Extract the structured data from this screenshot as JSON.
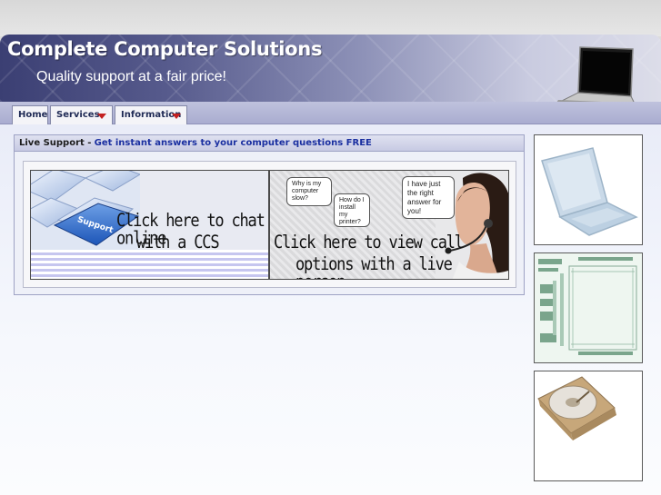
{
  "site": {
    "title": "Complete Computer Solutions",
    "tagline": "Quality support at a fair price!"
  },
  "nav": {
    "tabs": [
      {
        "label": "Home",
        "has_dropdown": false
      },
      {
        "label": "Services",
        "has_dropdown": true
      },
      {
        "label": "Information",
        "has_dropdown": true
      }
    ]
  },
  "live_support": {
    "heading": "Live Support -",
    "link_text": "Get instant answers to your computer questions FREE",
    "chat_promo": {
      "key_label": "Support",
      "line1": "Click here to chat online",
      "line2": "with a CCS technician."
    },
    "call_promo": {
      "bubble1": "Why is my computer slow?",
      "bubble2": "How do I install my printer?",
      "bubble3": "I have just the right answer for you!",
      "line1": "Click here to view call",
      "line2": "options with a live person."
    }
  },
  "colors": {
    "accent_link": "#1a2fa0",
    "nav_arrow": "#c42121",
    "banner_dark": "#3b3f73"
  }
}
